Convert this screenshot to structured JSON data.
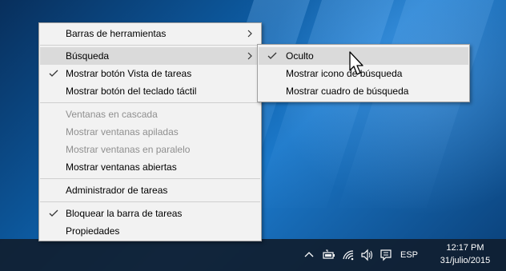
{
  "main_menu": {
    "items": [
      {
        "label": "Barras de herramientas",
        "checked": false,
        "disabled": false,
        "submenu": true
      },
      {
        "label": "Búsqueda",
        "checked": false,
        "disabled": false,
        "submenu": true,
        "highlighted": true
      },
      {
        "label": "Mostrar botón Vista de tareas",
        "checked": true,
        "disabled": false
      },
      {
        "label": "Mostrar botón del teclado táctil",
        "checked": false,
        "disabled": false
      },
      {
        "label": "Ventanas en cascada",
        "checked": false,
        "disabled": true
      },
      {
        "label": "Mostrar ventanas apiladas",
        "checked": false,
        "disabled": true
      },
      {
        "label": "Mostrar ventanas en paralelo",
        "checked": false,
        "disabled": true
      },
      {
        "label": "Mostrar ventanas abiertas",
        "checked": false,
        "disabled": false
      },
      {
        "label": "Administrador de tareas",
        "checked": false,
        "disabled": false
      },
      {
        "label": "Bloquear la barra de tareas",
        "checked": true,
        "disabled": false
      },
      {
        "label": "Propiedades",
        "checked": false,
        "disabled": false
      }
    ]
  },
  "submenu": {
    "items": [
      {
        "label": "Oculto",
        "checked": true,
        "highlighted": true
      },
      {
        "label": "Mostrar icono de búsqueda",
        "checked": false
      },
      {
        "label": "Mostrar cuadro de búsqueda",
        "checked": false
      }
    ]
  },
  "taskbar": {
    "tray_icons": [
      "chevron-up-icon",
      "battery-icon",
      "wifi-icon",
      "speaker-icon",
      "notifications-icon"
    ],
    "language": "ESP",
    "time": "12:17 PM",
    "date": "31/julio/2015"
  },
  "colors": {
    "menu_background": "#f2f2f2",
    "menu_highlight": "#dadada",
    "disabled_text": "#8f8f8f",
    "taskbar": "#101e30"
  }
}
